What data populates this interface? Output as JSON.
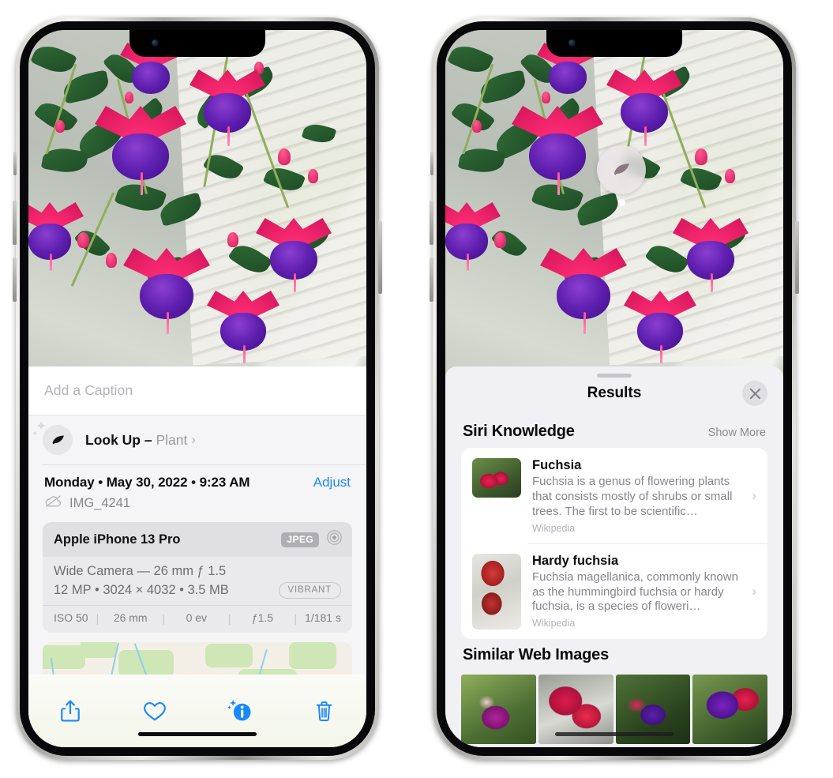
{
  "left_phone": {
    "name": "photos-detail-view",
    "caption_field": {
      "placeholder": "Add a Caption",
      "value": ""
    },
    "look_up": {
      "icon": "leaf-icon",
      "label": "Look Up",
      "dash": " – ",
      "subject": "Plant",
      "chevron": "›"
    },
    "date_line": "Monday • May 30, 2022 • 9:23 AM",
    "adjust_label": "Adjust",
    "file_icon": "cloud-slash-icon",
    "file_name": "IMG_4241",
    "exif": {
      "model": "Apple iPhone 13 Pro",
      "format_badge": "JPEG",
      "aperture_icon": "aperture-icon",
      "lens_line": "Wide Camera — 26 mm ƒ 1.5",
      "size_line": "12 MP  •  3024 × 4032  •  3.5 MB",
      "style_badge": "VIBRANT",
      "settings": [
        "ISO 50",
        "26 mm",
        "0 ev",
        "ƒ1.5",
        "1/181 s"
      ]
    },
    "toolbar": [
      {
        "name": "share-button",
        "icon": "share-icon"
      },
      {
        "name": "favorite-button",
        "icon": "heart-icon"
      },
      {
        "name": "info-button",
        "icon": "info-sparkle-icon"
      },
      {
        "name": "delete-button",
        "icon": "trash-icon"
      }
    ]
  },
  "right_phone": {
    "name": "visual-lookup-results",
    "photo_badge": {
      "icon": "leaf-icon",
      "label": "plant-badge"
    },
    "sheet": {
      "grabber": "drag-handle",
      "title": "Results",
      "close_icon": "close-icon"
    },
    "siri_knowledge": {
      "section_title": "Siri Knowledge",
      "show_more": "Show More",
      "items": [
        {
          "title": "Fuchsia",
          "description": "Fuchsia is a genus of flowering plants that consists mostly of shrubs or small trees. The first to be scientific…",
          "source": "Wikipedia",
          "chevron": "›",
          "thumb": "fuchsia-red-thumb"
        },
        {
          "title": "Hardy fuchsia",
          "description": "Fuchsia magellanica, commonly known as the hummingbird fuchsia or hardy fuchsia, is a species of floweri…",
          "source": "Wikipedia",
          "chevron": "›",
          "thumb": "hardy-fuchsia-thumb"
        }
      ]
    },
    "similar_web_images": {
      "section_title": "Similar Web Images",
      "items": [
        "web-image-1",
        "web-image-2",
        "web-image-3",
        "web-image-4"
      ]
    }
  },
  "colors": {
    "accent_blue": "#1a88ff",
    "sheet_bg": "#f5f5f7",
    "results_bg": "#f1f1f5",
    "secondary_text": "#86868c"
  }
}
